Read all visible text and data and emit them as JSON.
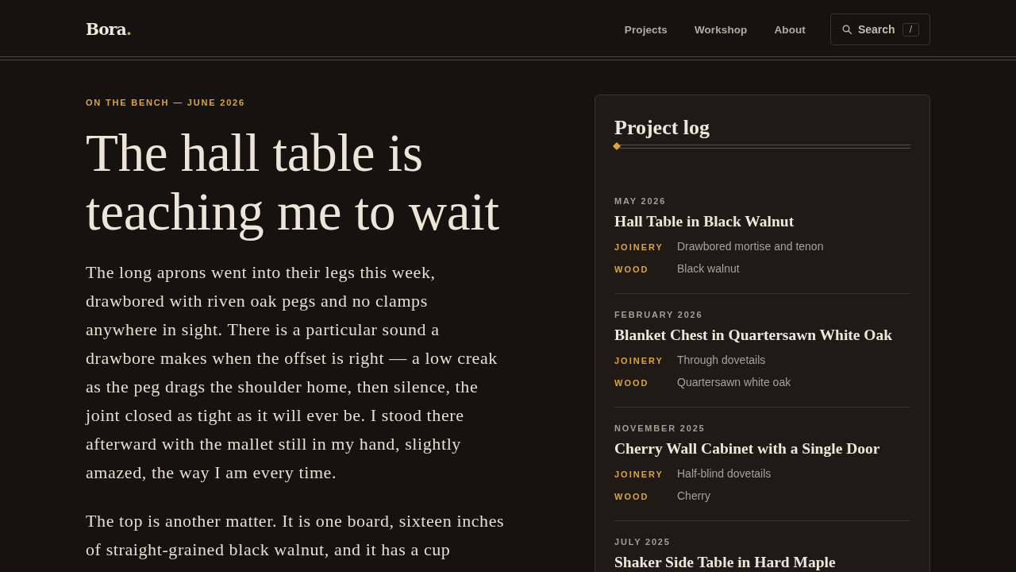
{
  "header": {
    "logo": {
      "name": "Bora",
      "mark": "."
    },
    "nav": [
      {
        "label": "Projects"
      },
      {
        "label": "Workshop"
      },
      {
        "label": "About"
      }
    ],
    "search": {
      "label": "Search",
      "shortcut": "/"
    }
  },
  "article": {
    "eyebrow": "ON THE BENCH — JUNE 2026",
    "title": "The hall table is teaching me to wait",
    "paragraphs": [
      "The long aprons went into their legs this week, drawbored with riven oak pegs and no clamps anywhere in sight. There is a particular sound a drawbore makes when the offset is right — a low creak as the peg drags the shoulder home, then silence, the joint closed as tight as it will ever be. I stood there afterward with the mallet still in my hand, slightly amazed, the way I am every time.",
      "The top is another matter. It is one board, sixteen inches of straight-grained black walnut, and it has a cup"
    ]
  },
  "project_log": {
    "title": "Project log",
    "entries": [
      {
        "date": "MAY 2026",
        "title": "Hall Table in Black Walnut",
        "details": [
          {
            "label": "JOINERY",
            "value": "Drawbored mortise and tenon"
          },
          {
            "label": "WOOD",
            "value": "Black walnut"
          }
        ]
      },
      {
        "date": "FEBRUARY 2026",
        "title": "Blanket Chest in Quartersawn White Oak",
        "details": [
          {
            "label": "JOINERY",
            "value": "Through dovetails"
          },
          {
            "label": "WOOD",
            "value": "Quartersawn white oak"
          }
        ]
      },
      {
        "date": "NOVEMBER 2025",
        "title": "Cherry Wall Cabinet with a Single Door",
        "details": [
          {
            "label": "JOINERY",
            "value": "Half-blind dovetails"
          },
          {
            "label": "WOOD",
            "value": "Cherry"
          }
        ]
      },
      {
        "date": "JULY 2025",
        "title": "Shaker Side Table in Hard Maple"
      }
    ]
  }
}
